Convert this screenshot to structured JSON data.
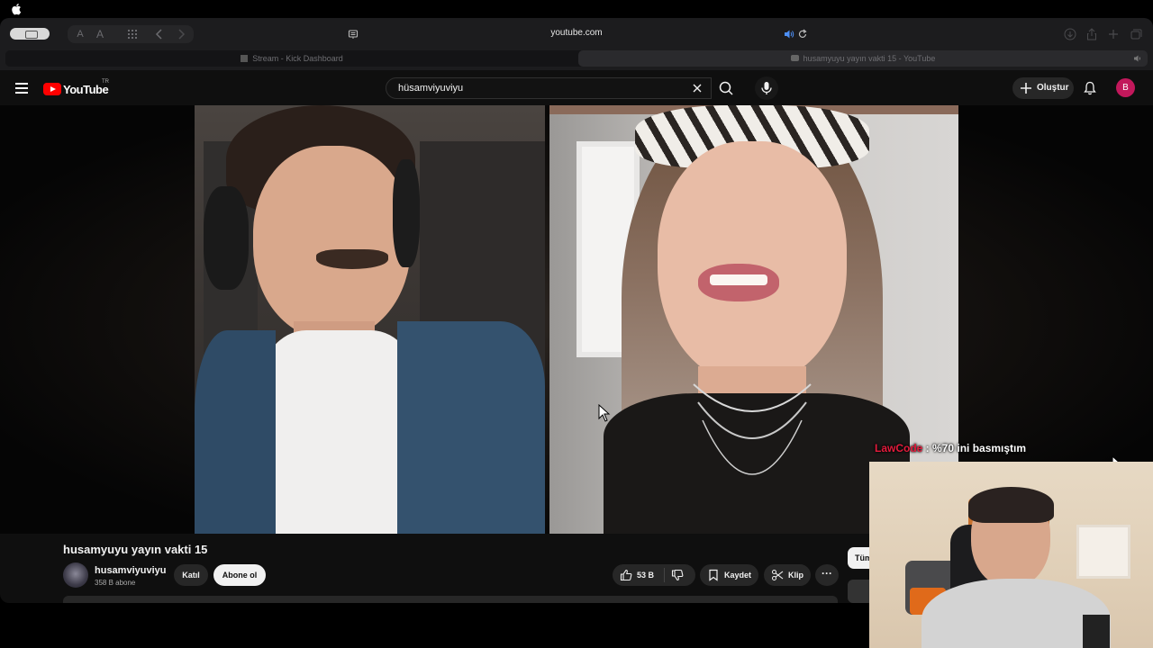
{
  "browser": {
    "address": "youtube.com",
    "tabs": [
      {
        "title": "Stream - Kick Dashboard"
      },
      {
        "title": "husamyuyu yayın vakti 15 - YouTube"
      }
    ]
  },
  "youtube": {
    "logo_text": "YouTube",
    "region_code": "TR",
    "search_value": "hüsamviyuviyu",
    "create_label": "Oluştur",
    "avatar_initial": "B",
    "accent_color": "#ff0000"
  },
  "video": {
    "title": "husamyuyu yayın vakti 15",
    "channel_name": "husamviyuviyu",
    "subscribers": "358 B abone",
    "join_label": "Katıl",
    "subscribe_label": "Abone ol",
    "like_count": "53 B",
    "save_label": "Kaydet",
    "clip_label": "Klip",
    "more_label": "···"
  },
  "recommendations": {
    "chip_label": "Tüm"
  },
  "stream_overlay": {
    "chat_user": "LawCode",
    "chat_message": " : %70 ini basmıştım",
    "chat_user_color": "#e41b3c"
  }
}
